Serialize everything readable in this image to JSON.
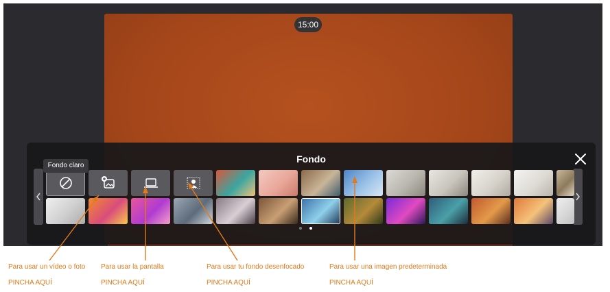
{
  "timer": "15:00",
  "panel": {
    "title": "Fondo"
  },
  "tooltip": "Fondo claro",
  "pager": {
    "count": 2,
    "active": 1
  },
  "annotations": [
    {
      "line1": "Para usar un vídeo o foto",
      "line2": "PINCHA AQUÍ"
    },
    {
      "line1": "Para usar la pantalla",
      "line2": "PINCHA AQUÍ"
    },
    {
      "line1": "Para usar tu fondo desenfocado",
      "line2": "PINCHA AQUÍ"
    },
    {
      "line1": "Para usar una imagen predeterminada",
      "line2": "PINCHA AQUÍ"
    }
  ],
  "backgrounds_row1": [
    {
      "name": "abstract-waves",
      "colors": [
        "#d9573b",
        "#3aa6a0",
        "#f0c27a"
      ]
    },
    {
      "name": "desserts",
      "colors": [
        "#f4c9c0",
        "#e9a79a",
        "#c97b6a"
      ]
    },
    {
      "name": "interior-office",
      "colors": [
        "#8b6b4a",
        "#c9b597",
        "#3f5f6e"
      ]
    },
    {
      "name": "city-skyline",
      "colors": [
        "#4f86c6",
        "#9cc3e8",
        "#d9e6f2"
      ]
    },
    {
      "name": "white-room",
      "colors": [
        "#dcdad5",
        "#b9b6ae",
        "#8a877f"
      ]
    },
    {
      "name": "white-hallway",
      "colors": [
        "#e8e6e1",
        "#c9c5bd",
        "#8c8880"
      ]
    },
    {
      "name": "minimal-room",
      "colors": [
        "#f1efeb",
        "#d7d3cb",
        "#b0aba1"
      ]
    },
    {
      "name": "bright-loft",
      "colors": [
        "#f4f3f1",
        "#dedbd5",
        "#bab5ac"
      ]
    },
    {
      "name": "partial",
      "colors": [
        "#c9b89b",
        "#8d7a5c",
        "#e1d6c2"
      ]
    }
  ],
  "backgrounds_row2": [
    {
      "name": "white-interior",
      "colors": [
        "#efefef",
        "#cfcfcf",
        "#aaaaaa"
      ]
    },
    {
      "name": "balloons-orange",
      "colors": [
        "#f28a2e",
        "#d94c7d",
        "#f7c948"
      ]
    },
    {
      "name": "balloons-pink",
      "colors": [
        "#e8569a",
        "#b03bd0",
        "#f4a1c8"
      ]
    },
    {
      "name": "bridge",
      "colors": [
        "#9aa7b5",
        "#5d6b7a",
        "#d1d6dc"
      ]
    },
    {
      "name": "abstract-gray",
      "colors": [
        "#8a7c86",
        "#d8cfd4",
        "#4a3f48"
      ]
    },
    {
      "name": "cafe",
      "colors": [
        "#7a5538",
        "#c99f74",
        "#3a2a1e"
      ]
    },
    {
      "name": "futuristic-city",
      "colors": [
        "#3b6fa8",
        "#8fd0ea",
        "#1f3554"
      ]
    },
    {
      "name": "forest",
      "colors": [
        "#5d6b2f",
        "#b58a3a",
        "#2e3a1a"
      ]
    },
    {
      "name": "nebula",
      "colors": [
        "#7a2bd8",
        "#e04ac0",
        "#2a1a5a"
      ]
    },
    {
      "name": "fantasy-land",
      "colors": [
        "#2e5d7a",
        "#4aa0a8",
        "#1b2e3a"
      ]
    },
    {
      "name": "autumn-village",
      "colors": [
        "#c25a2e",
        "#e39a4a",
        "#5a2e1e"
      ]
    },
    {
      "name": "sunset-valley",
      "colors": [
        "#e07a3a",
        "#f4c27a",
        "#5a4a6a"
      ]
    },
    {
      "name": "partial-white",
      "colors": [
        "#eeeeee",
        "#d8d8d8",
        "#c0c0c0"
      ]
    }
  ]
}
